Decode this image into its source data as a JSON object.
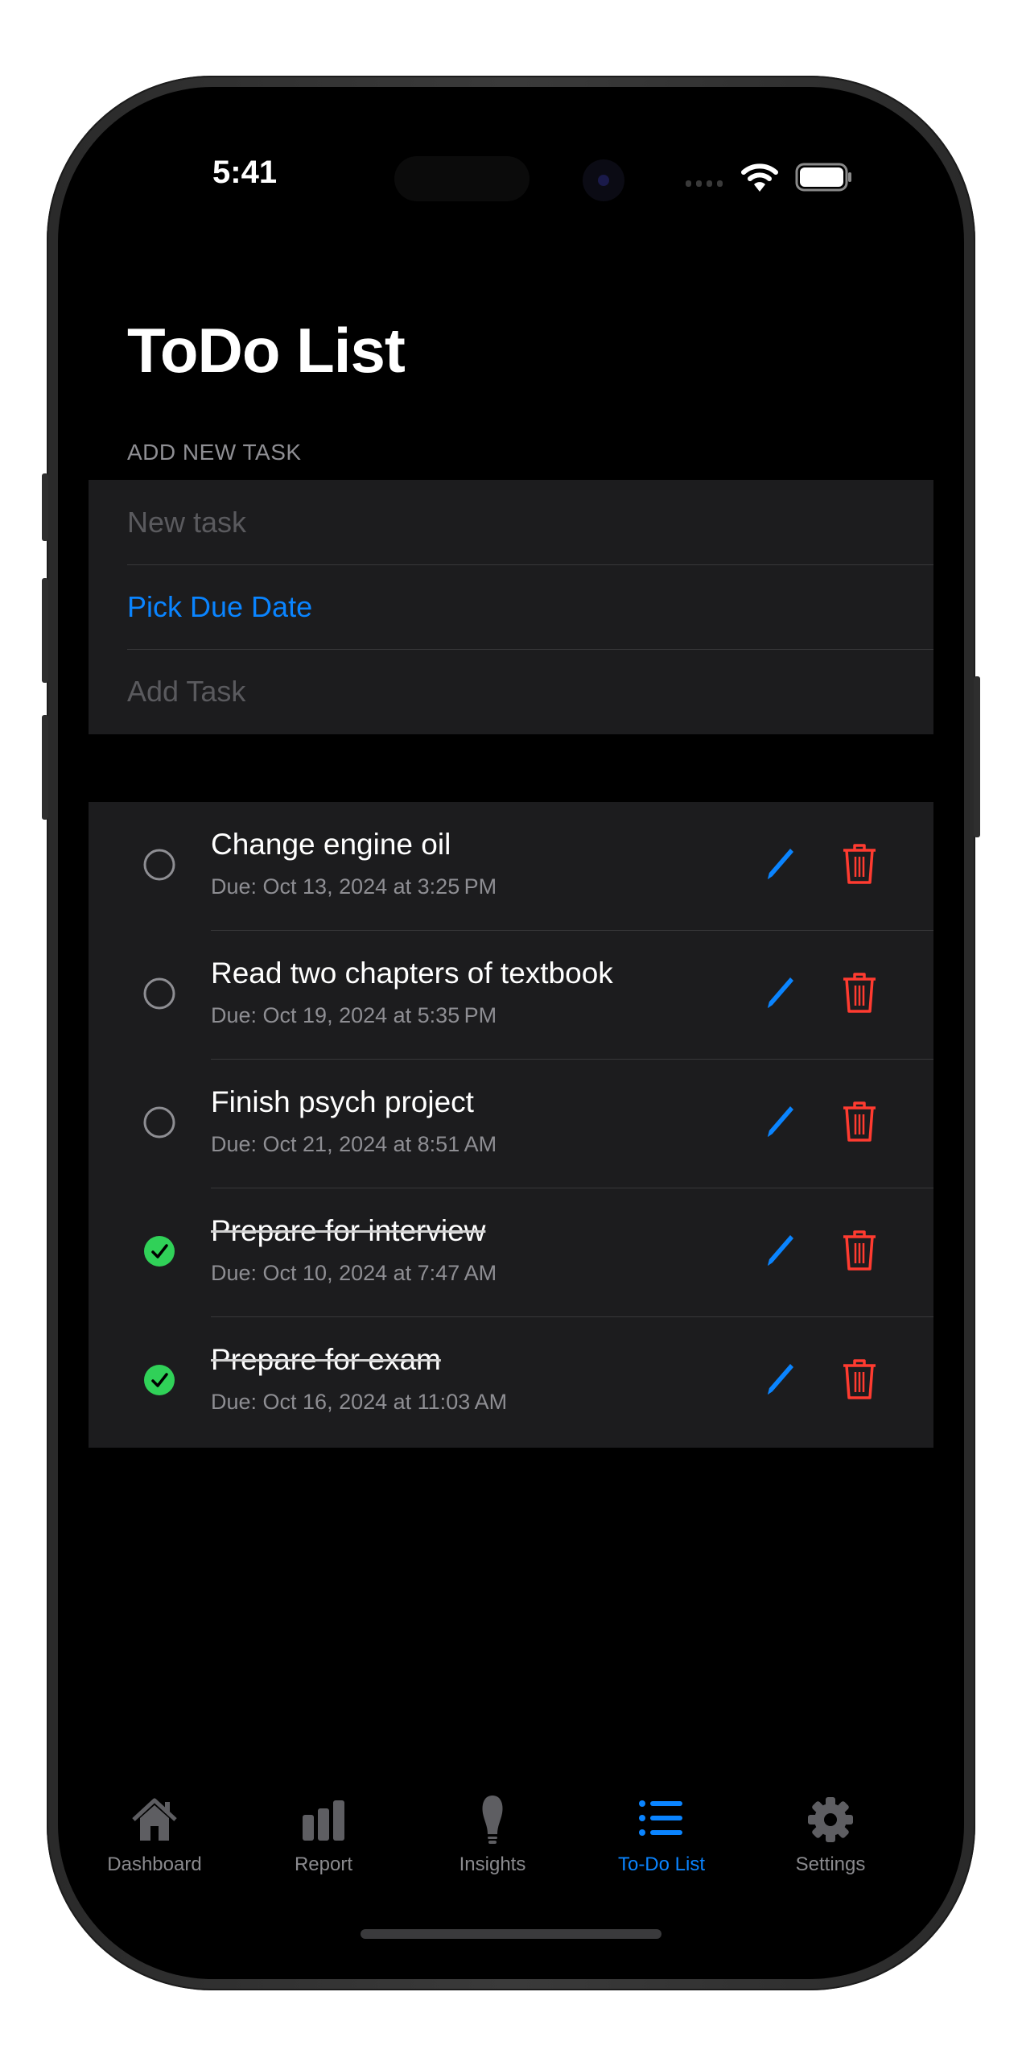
{
  "status_bar": {
    "time": "5:41",
    "icons": [
      "cellular-signal-icon",
      "wifi-icon",
      "battery-icon"
    ]
  },
  "header": {
    "title": "ToDo List"
  },
  "add_task": {
    "section_label": "ADD NEW TASK",
    "task_input_placeholder": "New task",
    "task_input_value": "",
    "pick_due_date_label": "Pick Due Date",
    "add_task_label": "Add Task"
  },
  "tasks": [
    {
      "title": "Change engine oil",
      "due": "Due: Oct 13, 2024 at 3:25 PM",
      "completed": false
    },
    {
      "title": "Read two chapters of textbook",
      "due": "Due: Oct 19, 2024 at 5:35 PM",
      "completed": false
    },
    {
      "title": "Finish psych project",
      "due": "Due: Oct 21, 2024 at 8:51 AM",
      "completed": false
    },
    {
      "title": "Prepare for interview",
      "due": "Due: Oct 10, 2024 at 7:47 AM",
      "completed": true
    },
    {
      "title": "Prepare for exam",
      "due": "Due: Oct 16, 2024 at 11:03 AM",
      "completed": true
    }
  ],
  "tab_bar": {
    "items": [
      {
        "label": "Dashboard",
        "icon": "house-icon",
        "active": false
      },
      {
        "label": "Report",
        "icon": "bar-chart-icon",
        "active": false
      },
      {
        "label": "Insights",
        "icon": "lightbulb-icon",
        "active": false
      },
      {
        "label": "To-Do List",
        "icon": "list-icon",
        "active": true
      },
      {
        "label": "Settings",
        "icon": "gear-icon",
        "active": false
      }
    ]
  },
  "colors": {
    "accent": "#0a84ff",
    "destructive": "#ff3b30",
    "success": "#30d158",
    "background": "#000000",
    "card": "#1c1c1e",
    "secondary_text": "#8e8e93",
    "inactive_tab": "#8a8a8e"
  }
}
